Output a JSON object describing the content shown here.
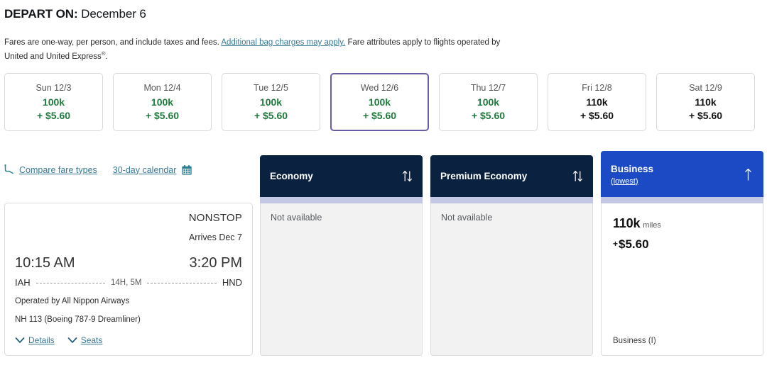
{
  "header": {
    "depart_label": "DEPART ON:",
    "depart_date": "December 6",
    "fare_note_pre": "Fares are one-way, per person, and include taxes and fees. ",
    "fare_note_link": "Additional bag charges may apply.",
    "fare_note_post": " Fare attributes apply to flights operated by United and United Express",
    "fare_note_mark": "®",
    "fare_note_end": "."
  },
  "date_strip": {
    "dates": [
      {
        "day": "Sun 12/3",
        "miles": "100k",
        "cash": "+ $5.60",
        "selected": false,
        "cheapest": true
      },
      {
        "day": "Mon 12/4",
        "miles": "100k",
        "cash": "+ $5.60",
        "selected": false,
        "cheapest": true
      },
      {
        "day": "Tue 12/5",
        "miles": "100k",
        "cash": "+ $5.60",
        "selected": false,
        "cheapest": true
      },
      {
        "day": "Wed 12/6",
        "miles": "100k",
        "cash": "+ $5.60",
        "selected": true,
        "cheapest": true
      },
      {
        "day": "Thu 12/7",
        "miles": "100k",
        "cash": "+ $5.60",
        "selected": false,
        "cheapest": true
      },
      {
        "day": "Fri 12/8",
        "miles": "110k",
        "cash": "+ $5.60",
        "selected": false,
        "cheapest": false
      },
      {
        "day": "Sat 12/9",
        "miles": "110k",
        "cash": "+ $5.60",
        "selected": false,
        "cheapest": false
      }
    ]
  },
  "utility_links": {
    "seat_icon": "airline-seat-icon",
    "compare_label": "Compare fare types",
    "calendar_label": "30-day calendar",
    "calendar_icon": "calendar-icon"
  },
  "cabins": [
    {
      "name": "Economy",
      "subtitle": "",
      "sort_icon": "sort-up-down-icon",
      "status": "Not available",
      "available": false,
      "miles": "",
      "miles_unit": "",
      "cash": "",
      "fare_class": ""
    },
    {
      "name": "Premium Economy",
      "subtitle": "",
      "sort_icon": "sort-up-down-icon",
      "status": "Not available",
      "available": false,
      "miles": "",
      "miles_unit": "",
      "cash": "",
      "fare_class": ""
    },
    {
      "name": "Business",
      "subtitle": "(lowest)",
      "sort_icon": "sort-up-icon",
      "status": "",
      "available": true,
      "miles": "110k",
      "miles_unit": "miles",
      "cash_plus": "+",
      "cash": "$5.60",
      "fare_class": "Business (I)"
    }
  ],
  "flight": {
    "nonstop": "NONSTOP",
    "arrives": "Arrives Dec 7",
    "depart_time": "10:15 AM",
    "arrive_time": "3:20 PM",
    "origin": "IAH",
    "destination": "HND",
    "duration": "14H, 5M",
    "operated_by": "Operated by All Nippon Airways",
    "equipment": "NH 113 (Boeing 787-9 Dreamliner)",
    "details_label": "Details",
    "seats_label": "Seats"
  },
  "colors": {
    "cheapest_green": "#1f7a3d",
    "selected_purple": "#6b5ca5",
    "header_navy": "#0a2240",
    "header_blue": "#1b4ac4",
    "link_teal": "#3a7a96",
    "strip_lavender": "#c4c8e4"
  }
}
